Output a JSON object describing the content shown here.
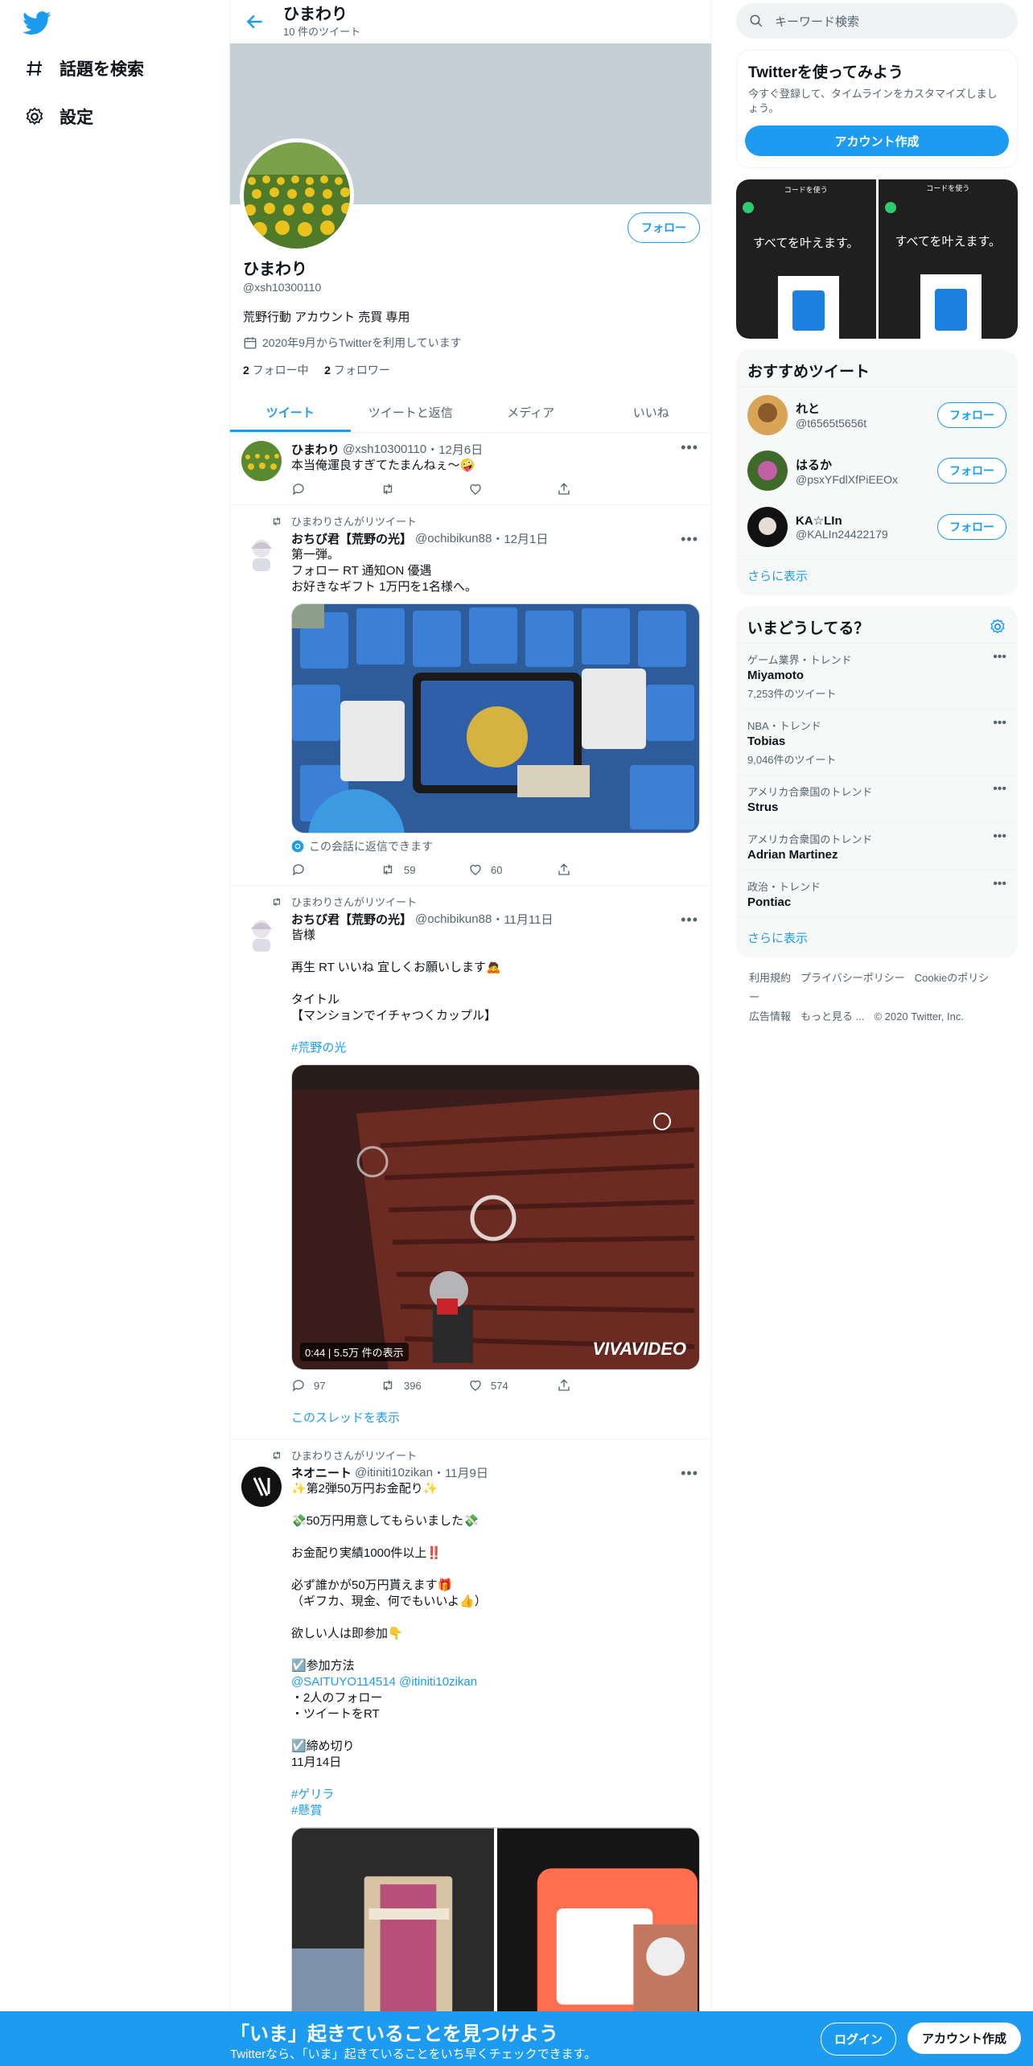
{
  "nav": {
    "explore": "話題を検索",
    "settings": "設定"
  },
  "profile": {
    "header_name": "ひまわり",
    "header_count": "10 件のツイート",
    "name": "ひまわり",
    "handle": "@xsh10300110",
    "bio": "荒野行動 アカウント 売買 専用",
    "joined": "2020年9月からTwitterを利用しています",
    "following_num": "2",
    "following_label": "フォロー中",
    "followers_num": "2",
    "followers_label": "フォロワー",
    "follow_label": "フォロー"
  },
  "tabs": [
    "ツイート",
    "ツイートと返信",
    "メディア",
    "いいね"
  ],
  "tweets": [
    {
      "name": "ひまわり",
      "handle": "@xsh10300110",
      "date": "・12月6日",
      "text": "本当俺運良すぎてたまんねぇ〜🤪"
    },
    {
      "rt_label": "ひまわりさんがリツイート",
      "name": "おちび君【荒野の光】",
      "handle": "@ochibikun88",
      "date": "・12月1日",
      "text": "第一弾。\nフォロー RT 通知ON 優遇\nお好きなギフト 1万円を1名様へ。",
      "reply_note": "この会話に返信できます",
      "retweets": "59",
      "likes": "60"
    },
    {
      "rt_label": "ひまわりさんがリツイート",
      "name": "おちび君【荒野の光】",
      "handle": "@ochibikun88",
      "date": "・11月11日",
      "text": "皆様\n\n再生 RT いいね 宜しくお願いします🙇\n\nタイトル\n【マンションでイチャつくカップル】",
      "hashtag": "#荒野の光",
      "video_time": "0:44",
      "video_views": "5.5万 件の表示",
      "video_watermark": "VIVAVIDEO",
      "replies": "97",
      "retweets": "396",
      "likes": "574",
      "show_thread": "このスレッドを表示"
    },
    {
      "rt_label": "ひまわりさんがリツイート",
      "name": "ネオニート",
      "handle": "@itiniti10zikan",
      "date": "・11月9日",
      "text_a": "✨第2弾50万円お金配り✨\n\n💸50万円用意してもらいました💸\n\nお金配り実績1000件以上‼️\n\n必ず誰かが50万円貰えます🎁\n（ギフカ、現金、何でもいいよ👍）\n\n欲しい人は即参加👇\n\n☑️参加方法",
      "mentions": "@SAITUYO114514 @itiniti10zikan",
      "text_b": "・2人のフォロー\n・ツイートをRT\n\n☑️締め切り\n11月14日",
      "hashtags": [
        "#ゲリラ",
        "#懸賞"
      ]
    }
  ],
  "right": {
    "search_placeholder": "キーワード検索",
    "signup_title": "Twitterを使ってみよう",
    "signup_sub": "今すぐ登録して、タイムラインをカスタマイズしましょう。",
    "signup_btn": "アカウント作成",
    "media_caption": "すべてを叶えます。",
    "media_header": "コードを使う",
    "recommended_title": "おすすめツイート",
    "suggestions": [
      {
        "name": "れと",
        "handle": "@t6565t5656t"
      },
      {
        "name": "はるか",
        "handle": "@psxYFdlXfPiEEOx"
      },
      {
        "name": "KA☆LIn",
        "handle": "@KALIn24422179"
      }
    ],
    "follow_label": "フォロー",
    "show_more": "さらに表示",
    "trends_title": "いまどうしてる？",
    "trends": [
      {
        "ctx": "ゲーム業界・トレンド",
        "title": "Miyamoto",
        "count": "7,253件のツイート"
      },
      {
        "ctx": "NBA・トレンド",
        "title": "Tobias",
        "count": "9,046件のツイート"
      },
      {
        "ctx": "アメリカ合衆国のトレンド",
        "title": "Strus",
        "count": ""
      },
      {
        "ctx": "アメリカ合衆国のトレンド",
        "title": "Adrian Martinez",
        "count": ""
      },
      {
        "ctx": "政治・トレンド",
        "title": "Pontiac",
        "count": ""
      }
    ],
    "footer_line1": [
      "利用規約",
      "プライバシーポリシー",
      "Cookieのポリシー"
    ],
    "footer_line2": [
      "広告情報",
      "もっと見る ...",
      "© 2020 Twitter, Inc."
    ]
  },
  "bottom": {
    "title": "「いま」起きていることを見つけよう",
    "sub": "Twitterなら、「いま」起きていることをいち早くチェックできます。",
    "login": "ログイン",
    "signup": "アカウント作成"
  },
  "colors": {
    "accent": "#1d9bf0",
    "banner": "#c4cfd6"
  }
}
